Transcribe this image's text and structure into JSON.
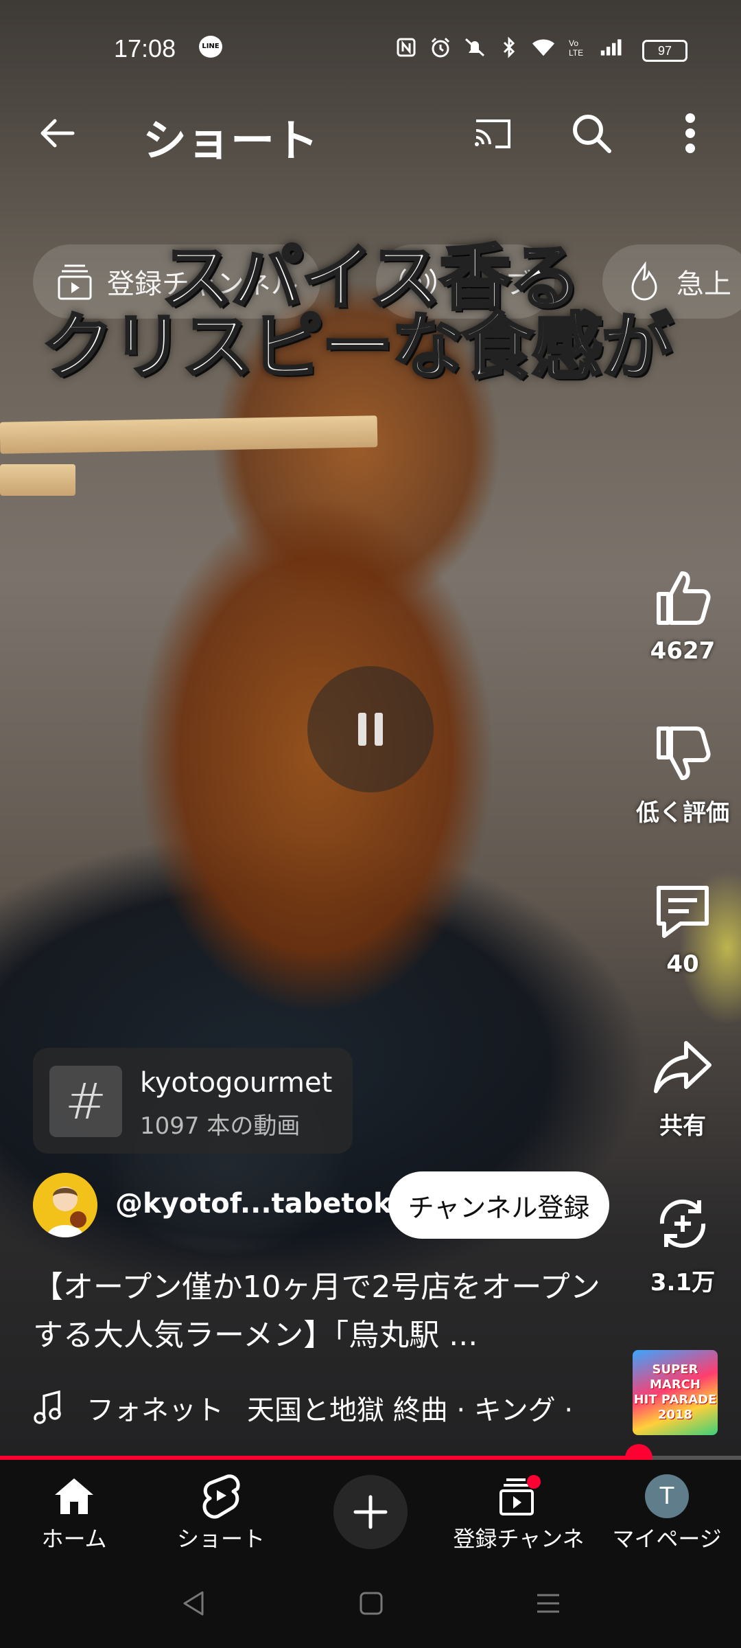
{
  "status_bar": {
    "time": "17:08",
    "line_app": "LINE",
    "battery": "97",
    "icons": [
      "nfc-icon",
      "alarm-icon",
      "mute-icon",
      "bluetooth-icon",
      "wifi-icon",
      "volte-icon",
      "signal-icon",
      "battery-icon"
    ]
  },
  "header": {
    "title": "ショート"
  },
  "chips": [
    {
      "label": "登録チャンネル",
      "icon": "subscriptions-icon"
    },
    {
      "label": "ライブ",
      "icon": "live-icon"
    },
    {
      "label": "急上",
      "icon": "trending-icon"
    }
  ],
  "overlay_caption": {
    "line1": "スパイス香る",
    "line2": "クリスピーな食感が"
  },
  "actions": {
    "like_count": "4627",
    "dislike_label": "低く評価",
    "comment_count": "40",
    "share_label": "共有",
    "remix_count": "3.1万"
  },
  "hashtag": {
    "name": "kyotogourmet",
    "count": "1097 本の動画"
  },
  "channel": {
    "handle": "@kyotof...tabetoku",
    "subscribe_label": "チャンネル登録"
  },
  "video": {
    "title": "【オープン僅か10ヶ月で2号店をオープンする大人気ラーメン】「烏丸駅 ..."
  },
  "music": {
    "artist": "フォネット",
    "track": "天国と地獄 終曲 · キング ·",
    "thumb_line1": "SUPER",
    "thumb_line2": "MARCH",
    "thumb_line3": "HIT PARADE",
    "thumb_line4": "2018"
  },
  "playback": {
    "progress": 0.862,
    "accent_color": "#ff0033"
  },
  "bottom_nav": {
    "home": "ホーム",
    "shorts": "ショート",
    "subscriptions": "登録チャンネル",
    "mypage": "マイページ",
    "avatar_initial": "T"
  }
}
